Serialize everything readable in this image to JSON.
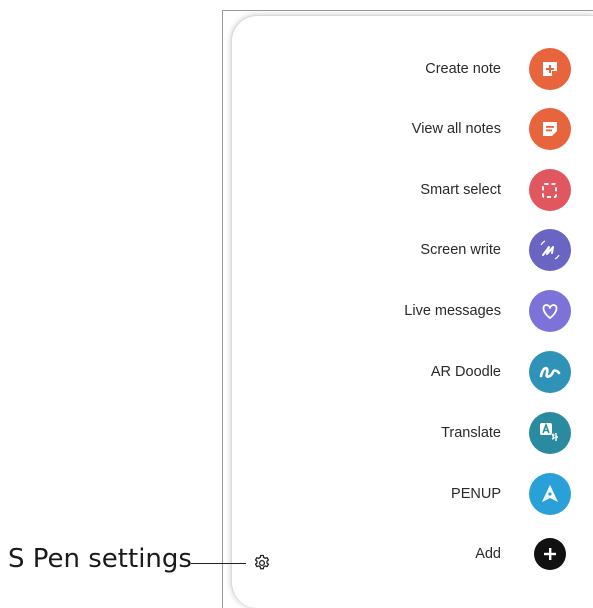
{
  "menu": {
    "items": [
      {
        "label": "Create note",
        "icon": "create-note-icon",
        "color": "#e8643c"
      },
      {
        "label": "View all notes",
        "icon": "view-all-notes-icon",
        "color": "#e8643c"
      },
      {
        "label": "Smart select",
        "icon": "smart-select-icon",
        "color": "#e05760"
      },
      {
        "label": "Screen write",
        "icon": "screen-write-icon",
        "color": "#6a64c2"
      },
      {
        "label": "Live messages",
        "icon": "live-messages-icon",
        "color": "#7d72d8"
      },
      {
        "label": "AR Doodle",
        "icon": "ar-doodle-icon",
        "color": "#2e93b6"
      },
      {
        "label": "Translate",
        "icon": "translate-icon",
        "color": "#2a8aa0"
      },
      {
        "label": "PENUP",
        "icon": "penup-icon",
        "color": "#2aa0d8"
      },
      {
        "label": "Add",
        "icon": "add-icon",
        "color": "#111111"
      }
    ]
  },
  "callout": {
    "label": "S Pen settings",
    "icon": "gear-icon"
  }
}
